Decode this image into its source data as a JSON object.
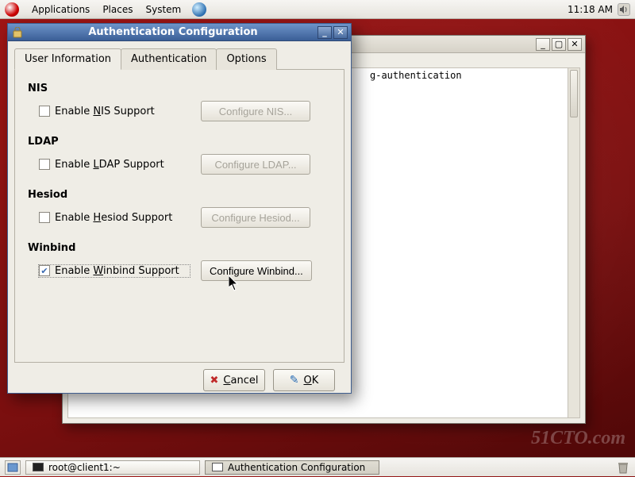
{
  "panel": {
    "menus": [
      "Applications",
      "Places",
      "System"
    ],
    "clock": "11:18 AM"
  },
  "terminal": {
    "visible_text": "g-authentication"
  },
  "dialog": {
    "title": "Authentication Configuration",
    "tabs": [
      "User Information",
      "Authentication",
      "Options"
    ],
    "active_tab": 0,
    "sections": {
      "nis": {
        "title": "NIS",
        "check_label_pre": "Enable ",
        "check_accel": "N",
        "check_label_post": "IS Support",
        "checked": false,
        "button": "Configure NIS..."
      },
      "ldap": {
        "title": "LDAP",
        "check_label_pre": "Enable ",
        "check_accel": "L",
        "check_label_post": "DAP Support",
        "checked": false,
        "button": "Configure LDAP..."
      },
      "hesiod": {
        "title": "Hesiod",
        "check_label_pre": "Enable ",
        "check_accel": "H",
        "check_label_post": "esiod Support",
        "checked": false,
        "button": "Configure Hesiod..."
      },
      "winbind": {
        "title": "Winbind",
        "check_label_pre": "Enable ",
        "check_accel": "W",
        "check_label_post": "inbind Support",
        "checked": true,
        "button_pre": "Confi",
        "button_accel": "g",
        "button_post": "ure Winbind..."
      }
    },
    "cancel_accel": "C",
    "cancel_post": "ancel",
    "ok_accel": "O",
    "ok_post": "K"
  },
  "taskbar": {
    "tasks": [
      {
        "label": "root@client1:~",
        "active": false
      },
      {
        "label": "Authentication Configuration",
        "active": true
      }
    ]
  },
  "watermark": "51CTO.com"
}
